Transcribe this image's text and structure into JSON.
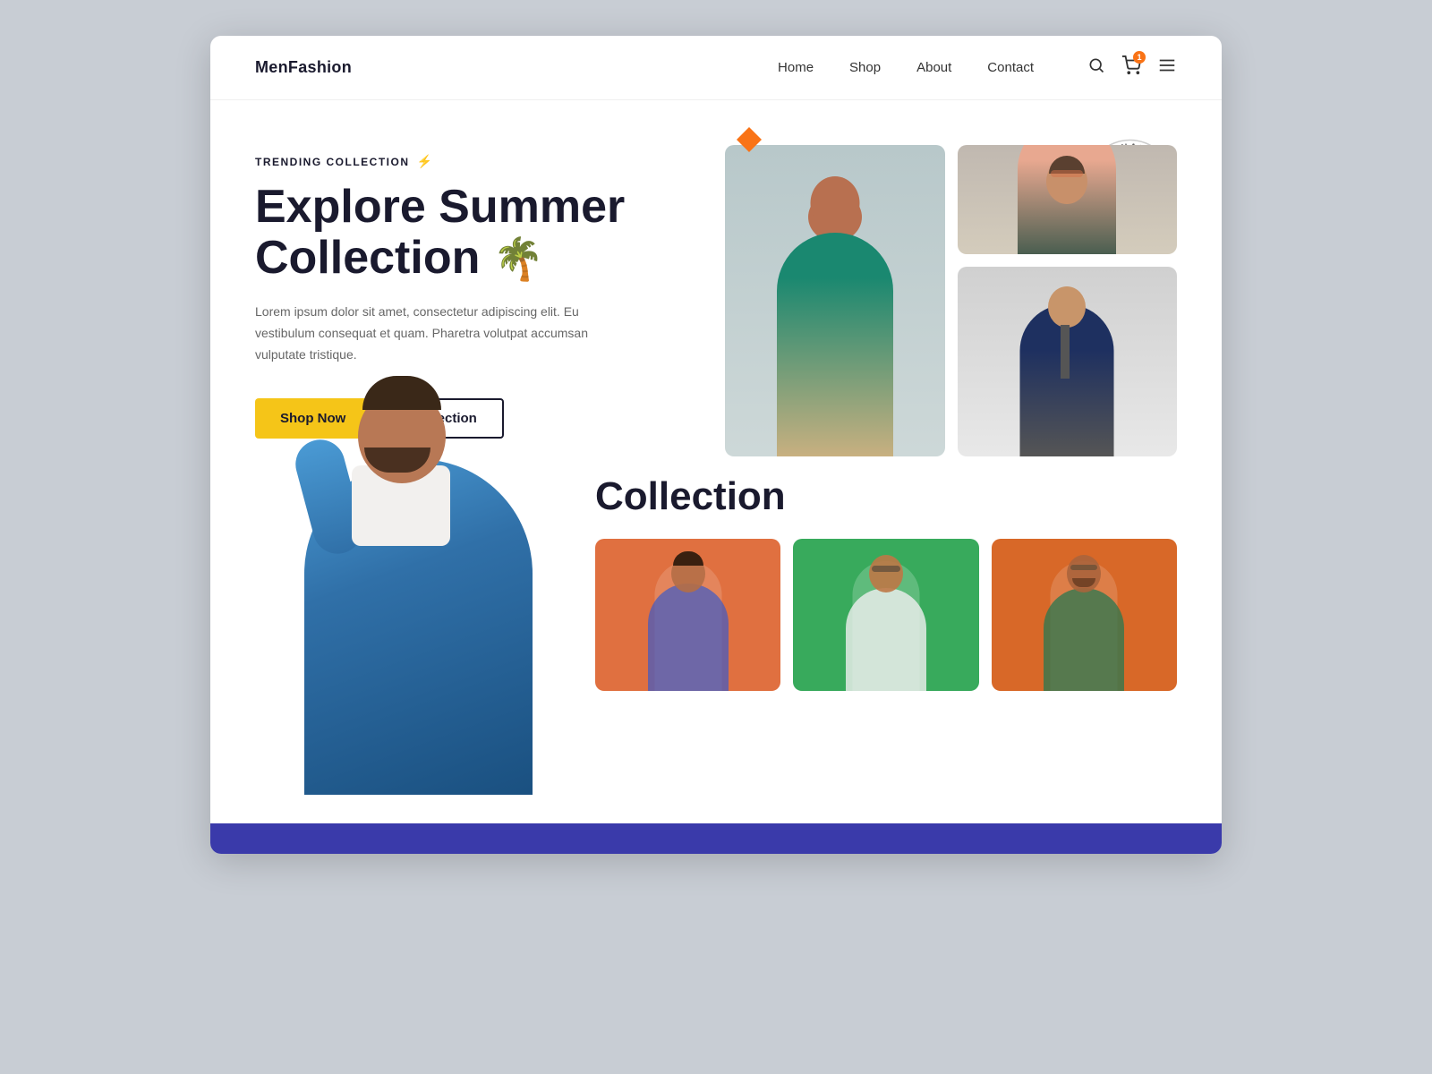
{
  "brand": {
    "name": "MenFashion"
  },
  "nav": {
    "links": [
      {
        "label": "Home",
        "id": "home"
      },
      {
        "label": "Shop",
        "id": "shop"
      },
      {
        "label": "About",
        "id": "about"
      },
      {
        "label": "Contact",
        "id": "contact"
      }
    ],
    "cart_count": "1"
  },
  "hero": {
    "tag": "TRENDING COLLECTION",
    "title_line1": "Explore Summer",
    "title_line2": "Collection",
    "palm_emoji": "🌴",
    "description": "Lorem ipsum dolor sit amet, consectetur adipiscing elit. Eu vestibulum consequat et quam. Pharetra volutpat accumsan vulputate tristique.",
    "btn_shop": "Shop Now",
    "btn_collection": "Collection",
    "quality_text_arc": "BEST QUALITY · BEST QUALITY ·"
  },
  "collection": {
    "heading": "Collection"
  },
  "colors": {
    "accent_yellow": "#f5c518",
    "accent_orange": "#f97316",
    "navy": "#1a1a2e",
    "bottom_bar": "#3a3aaa"
  }
}
